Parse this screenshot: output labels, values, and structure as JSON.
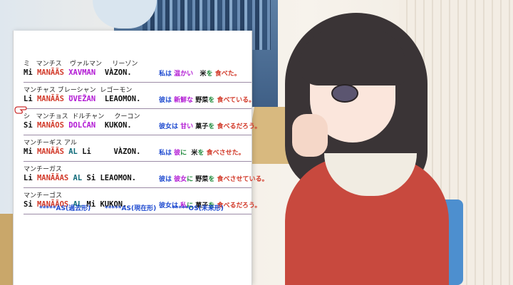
{
  "rows": [
    {
      "kana": "ミ   マンチス    ヴァルマン     リーゾン",
      "roman": [
        {
          "t": "Mi ",
          "c": "c-blk"
        },
        {
          "t": "MANĀÃS ",
          "c": "c-red"
        },
        {
          "t": "XAVMAN ",
          "c": "c-pur"
        },
        {
          "t": " VÀZON.",
          "c": "c-blk"
        }
      ],
      "jp": [
        {
          "t": "私は ",
          "c": "c-blu"
        },
        {
          "t": "温かい ",
          "c": "c-pur"
        },
        {
          "t": "  米",
          "c": "c-blk"
        },
        {
          "t": "を ",
          "c": "c-grn"
        },
        {
          "t": "食べた。",
          "c": "c-red"
        }
      ]
    },
    {
      "kana": "マンチャス ブレーシャン  レゴーモン",
      "roman": [
        {
          "t": "Li ",
          "c": "c-blk"
        },
        {
          "t": "MANĀÃS ",
          "c": "c-red"
        },
        {
          "t": "ƱVEŽAN ",
          "c": "c-pur"
        },
        {
          "t": " LEAOMON.",
          "c": "c-blk"
        }
      ],
      "jp": [
        {
          "t": "彼は ",
          "c": "c-blu"
        },
        {
          "t": "新鮮な ",
          "c": "c-pur"
        },
        {
          "t": "野菜",
          "c": "c-blk"
        },
        {
          "t": "を ",
          "c": "c-grn"
        },
        {
          "t": "食べている。",
          "c": "c-red"
        }
      ]
    },
    {
      "kana": "シ   マンチョス  ドルチャン     クーコン",
      "roman": [
        {
          "t": "Si ",
          "c": "c-blk"
        },
        {
          "t": "MANĀOS ",
          "c": "c-red"
        },
        {
          "t": "DOLČAN ",
          "c": "c-pur"
        },
        {
          "t": " KUKON.",
          "c": "c-blk"
        }
      ],
      "jp": [
        {
          "t": "彼女は ",
          "c": "c-blu"
        },
        {
          "t": "甘い ",
          "c": "c-pur"
        },
        {
          "t": "菓子",
          "c": "c-blk"
        },
        {
          "t": "を ",
          "c": "c-grn"
        },
        {
          "t": "食べるだろう。",
          "c": "c-red"
        }
      ]
    },
    {
      "kana": "マンチーギス アル",
      "roman": [
        {
          "t": "Mi ",
          "c": "c-blk"
        },
        {
          "t": "MANĀÃS ",
          "c": "c-red"
        },
        {
          "t": "AL ",
          "c": "c-dgrn"
        },
        {
          "t": "Li ",
          "c": "c-blk"
        },
        {
          "t": "    VÀZON.",
          "c": "c-blk"
        }
      ],
      "jp": [
        {
          "t": "私は ",
          "c": "c-blu"
        },
        {
          "t": "彼",
          "c": "c-pur"
        },
        {
          "t": "に ",
          "c": "c-grn"
        },
        {
          "t": " 米",
          "c": "c-blk"
        },
        {
          "t": "を ",
          "c": "c-grn"
        },
        {
          "t": "食べさせた。",
          "c": "c-red"
        }
      ]
    },
    {
      "kana": "マンチーガス",
      "roman": [
        {
          "t": "Li ",
          "c": "c-blk"
        },
        {
          "t": "MANĀÃAS ",
          "c": "c-red"
        },
        {
          "t": "AL ",
          "c": "c-dgrn"
        },
        {
          "t": "Si ",
          "c": "c-blk"
        },
        {
          "t": "LEAOMON.",
          "c": "c-blk"
        }
      ],
      "jp": [
        {
          "t": "彼は ",
          "c": "c-blu"
        },
        {
          "t": "彼女",
          "c": "c-pur"
        },
        {
          "t": "に ",
          "c": "c-grn"
        },
        {
          "t": "野菜",
          "c": "c-blk"
        },
        {
          "t": "を ",
          "c": "c-grn"
        },
        {
          "t": "食べさせている。",
          "c": "c-red"
        }
      ]
    },
    {
      "kana": "マンチーゴス",
      "roman": [
        {
          "t": "Si ",
          "c": "c-blk"
        },
        {
          "t": "MANĀÃOS ",
          "c": "c-red"
        },
        {
          "t": "AL ",
          "c": "c-dgrn"
        },
        {
          "t": "Mi ",
          "c": "c-blk"
        },
        {
          "t": "KUKON.",
          "c": "c-blk"
        }
      ],
      "jp": [
        {
          "t": "彼女は ",
          "c": "c-blu"
        },
        {
          "t": "私",
          "c": "c-pur"
        },
        {
          "t": "に ",
          "c": "c-grn"
        },
        {
          "t": "菓子",
          "c": "c-blk"
        },
        {
          "t": "を ",
          "c": "c-grn"
        },
        {
          "t": "食べるだろう。",
          "c": "c-red"
        }
      ]
    }
  ],
  "legend": [
    {
      "text": "*****ÀS(過去形)"
    },
    {
      "text": "*****AS(現在形)"
    },
    {
      "text": "*****OS(未来形)"
    }
  ],
  "icons": {
    "cursor": "pointing-hand-icon"
  }
}
